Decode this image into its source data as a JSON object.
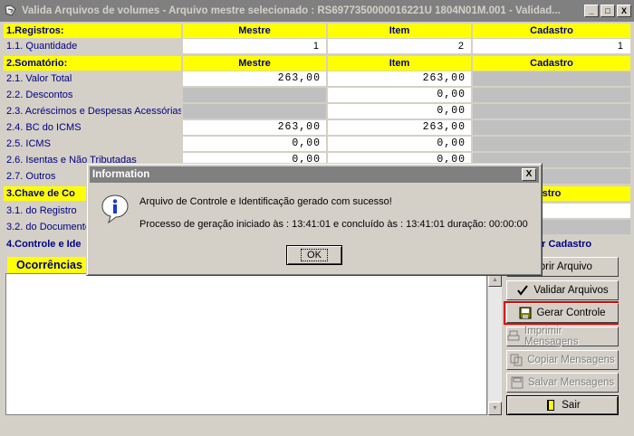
{
  "window": {
    "title": "Valida Arquivos de volumes - Arquivo mestre selecionado : RS6977350000016221U  1804N01M.001  - Validad...",
    "minimize": "_",
    "maximize": "□",
    "close": "X"
  },
  "columns": {
    "mestre": "Mestre",
    "item": "Item",
    "cadastro": "Cadastro"
  },
  "registros": {
    "title": "1.Registros:",
    "rows": [
      {
        "label": "1.1. Quantidade",
        "mestre": "1",
        "item": "2",
        "cadastro": "1"
      }
    ]
  },
  "somatorio": {
    "title": "2.Somatório:",
    "rows": [
      {
        "label": "2.1. Valor Total",
        "mestre": "263,00",
        "item": "263,00"
      },
      {
        "label": "2.2. Descontos",
        "mestre": "",
        "item": "0,00"
      },
      {
        "label": "2.3. Acréscimos e Despesas Acessórias",
        "mestre": "",
        "item": "0,00"
      },
      {
        "label": "2.4. BC do ICMS",
        "mestre": "263,00",
        "item": "263,00"
      },
      {
        "label": "2.5. ICMS",
        "mestre": "0,00",
        "item": "0,00"
      },
      {
        "label": "2.6. Isentas e Não Tributadas",
        "mestre": "0,00",
        "item": "0,00"
      },
      {
        "label": "2.7. Outros",
        "mestre": "",
        "item": ""
      }
    ]
  },
  "chave": {
    "title": "3.Chave de Co",
    "cadastro_header": "stro",
    "rows": [
      {
        "label": "3.1. do Registro"
      },
      {
        "label": "3.2. do Documento"
      }
    ]
  },
  "controle": {
    "title": "4.Controle e Ide",
    "right_label": "ar Cadastro"
  },
  "ocorrencias": {
    "title": "Ocorrências"
  },
  "buttons": {
    "abrir": "Abrir Arquivo",
    "validar": "Validar Arquivos",
    "gerar": "Gerar Controle",
    "imprimir": "Imprimir Mensagens",
    "copiar": "Copiar Mensagens",
    "salvar": "Salvar Mensagens",
    "sair": "Sair"
  },
  "dialog": {
    "title": "Information",
    "close": "X",
    "message_1": "Arquivo de Controle e Identificação gerado com sucesso!",
    "message_2": "Processo de geração iniciado às : 13:41:01 e concluído às : 13:41:01 duração: 00:00:00",
    "ok": "OK"
  }
}
